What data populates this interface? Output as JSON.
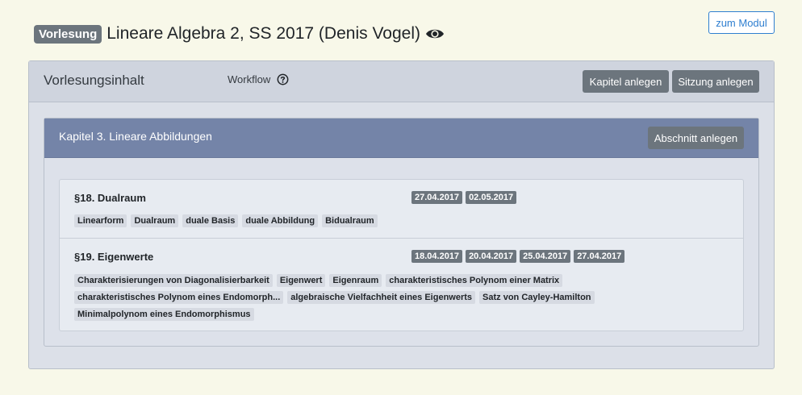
{
  "header": {
    "badge": "Vorlesung",
    "title": "Lineare Algebra 2, SS 2017 (Denis Vogel)",
    "modul_button": "zum Modul"
  },
  "content": {
    "title": "Vorlesungsinhalt",
    "workflow_label": "Workflow",
    "kapitel_button": "Kapitel anlegen",
    "sitzung_button": "Sitzung anlegen"
  },
  "chapter": {
    "title": "Kapitel 3. Lineare Abbildungen",
    "abschnitt_button": "Abschnitt anlegen",
    "sections": [
      {
        "title": "§18. Dualraum",
        "dates": [
          "27.04.2017",
          "02.05.2017"
        ],
        "tags": [
          "Linearform",
          "Dualraum",
          "duale Basis",
          "duale Abbildung",
          "Bidualraum"
        ]
      },
      {
        "title": "§19. Eigenwerte",
        "dates": [
          "18.04.2017",
          "20.04.2017",
          "25.04.2017",
          "27.04.2017"
        ],
        "tags": [
          "Charakterisierungen von Diagonalisierbarkeit",
          "Eigenwert",
          "Eigenraum",
          "charakteristisches Polynom einer Matrix",
          "charakteristisches Polynom eines Endomorph...",
          "algebraische Vielfachheit eines Eigenwerts",
          "Satz von Cayley-Hamilton",
          "Minimalpolynom eines Endomorphismus"
        ]
      }
    ]
  },
  "colors": {
    "page_bg": "#f8f8e9",
    "chapter_header": "#7484a8",
    "button_gray": "#6c757d",
    "link_blue": "#2f7fd0"
  },
  "icons": {
    "eye": "eye-icon",
    "help": "question-circle-icon"
  }
}
